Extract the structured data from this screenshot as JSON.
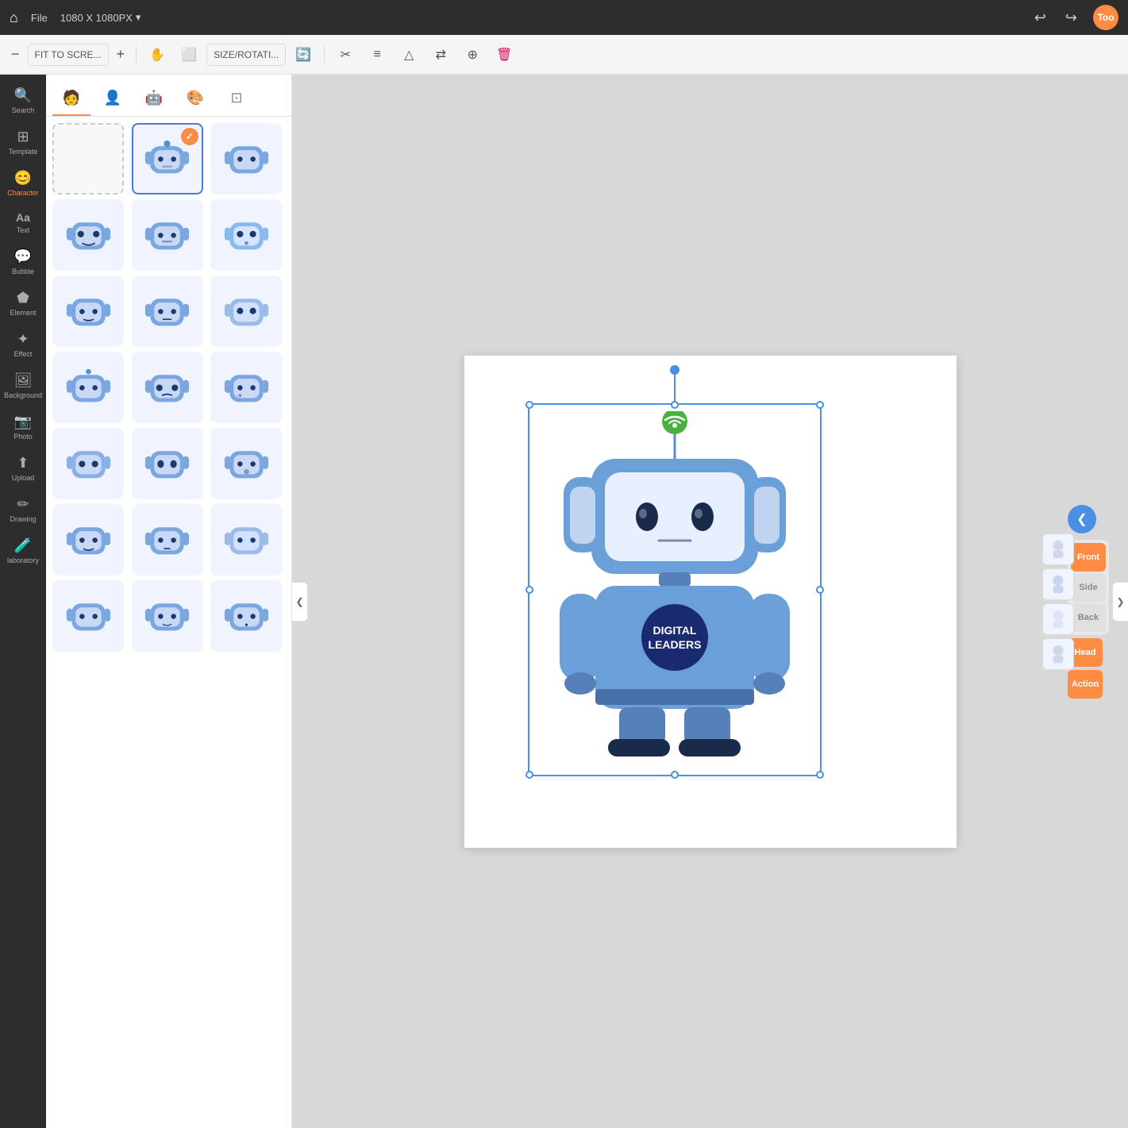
{
  "topbar": {
    "file_label": "File",
    "size_label": "1080 X 1080PX",
    "avatar_text": "Too",
    "undo_label": "↩",
    "redo_label": "↪"
  },
  "toolbar": {
    "zoom_out": "−",
    "zoom_label": "FIT TO SCRE...",
    "zoom_in": "+",
    "size_rotation_label": "SIZE/ROTATI..."
  },
  "left_nav": {
    "items": [
      {
        "id": "search",
        "label": "Search",
        "icon": "🔍"
      },
      {
        "id": "template",
        "label": "Template",
        "icon": "⊞"
      },
      {
        "id": "character",
        "label": "Character",
        "icon": "😊",
        "active": true
      },
      {
        "id": "text",
        "label": "Text",
        "icon": "Aa"
      },
      {
        "id": "bubble",
        "label": "Bubble",
        "icon": "💬"
      },
      {
        "id": "element",
        "label": "Element",
        "icon": "⬟"
      },
      {
        "id": "effect",
        "label": "Effect",
        "icon": "✦"
      },
      {
        "id": "background",
        "label": "Background",
        "icon": "🖼"
      },
      {
        "id": "photo",
        "label": "Photo",
        "icon": "📷"
      },
      {
        "id": "upload",
        "label": "Upload",
        "icon": "⬆"
      },
      {
        "id": "drawing",
        "label": "Drawing",
        "icon": "✏"
      },
      {
        "id": "laboratory",
        "label": "laboratory",
        "icon": "🧪"
      }
    ]
  },
  "panel": {
    "tabs": [
      {
        "id": "pose",
        "icon": "🧑",
        "active": true
      },
      {
        "id": "head",
        "icon": "👤"
      },
      {
        "id": "body",
        "icon": "🤖"
      },
      {
        "id": "accessory",
        "icon": "🎨"
      },
      {
        "id": "crop",
        "icon": "⊡"
      }
    ],
    "character_grid": [
      {
        "id": "empty",
        "type": "empty"
      },
      {
        "id": "char1",
        "type": "robot",
        "selected": true,
        "has_check": true
      },
      {
        "id": "char2",
        "type": "robot"
      },
      {
        "id": "char3",
        "type": "robot"
      },
      {
        "id": "char4",
        "type": "robot"
      },
      {
        "id": "char5",
        "type": "robot"
      },
      {
        "id": "char6",
        "type": "robot"
      },
      {
        "id": "char7",
        "type": "robot"
      },
      {
        "id": "char8",
        "type": "robot"
      },
      {
        "id": "char9",
        "type": "robot"
      },
      {
        "id": "char10",
        "type": "robot"
      },
      {
        "id": "char11",
        "type": "robot"
      },
      {
        "id": "char12",
        "type": "robot"
      },
      {
        "id": "char13",
        "type": "robot"
      },
      {
        "id": "char14",
        "type": "robot"
      },
      {
        "id": "char15",
        "type": "robot"
      },
      {
        "id": "char16",
        "type": "robot"
      },
      {
        "id": "char17",
        "type": "robot"
      },
      {
        "id": "char18",
        "type": "robot"
      },
      {
        "id": "char19",
        "type": "robot"
      },
      {
        "id": "char20",
        "type": "robot"
      },
      {
        "id": "char21",
        "type": "robot"
      },
      {
        "id": "char22",
        "type": "robot"
      },
      {
        "id": "char23",
        "type": "robot"
      }
    ]
  },
  "view_controls": {
    "collapse_icon": "❮",
    "front_label": "Front",
    "side_label": "Side",
    "back_label": "Back",
    "head_label": "Head",
    "action_label": "Action"
  },
  "canvas": {
    "character_text": "DIGITAL\nLEADERS"
  }
}
